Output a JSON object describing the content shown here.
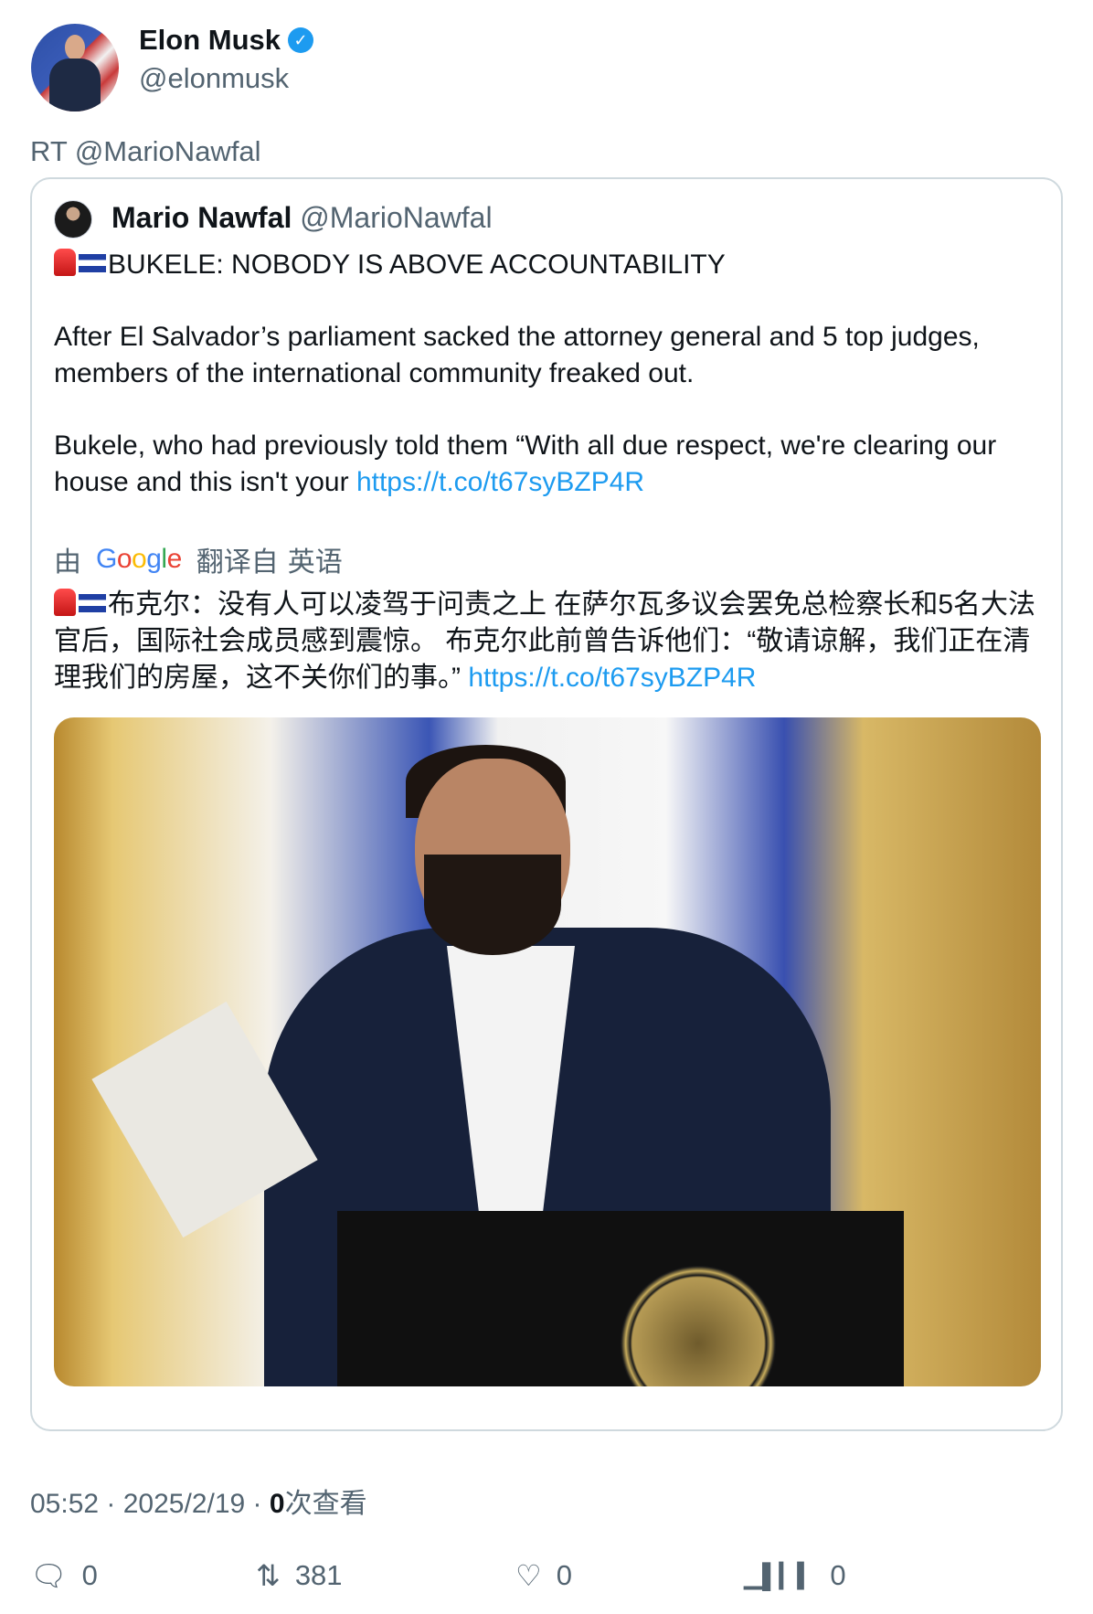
{
  "author": {
    "name": "Elon Musk",
    "handle": "@elonmusk",
    "verified": true
  },
  "retweet_label": "RT @MarioNawfal",
  "quoted": {
    "name": "Mario Nawfal",
    "handle": "@MarioNawfal",
    "headline": "BUKELE: NOBODY IS ABOVE ACCOUNTABILITY",
    "paragraph1": "After El Salvador’s parliament sacked the attorney general and 5 top judges, members of the international community freaked out.",
    "paragraph2": "Bukele, who had previously told them “With all due respect, we're clearing our house and this isn't your ",
    "link": "https://t.co/t67syBZP4R",
    "translation": {
      "by": "由",
      "provider": "Google",
      "from": "翻译自",
      "language": "英语",
      "text": "布克尔：没有人可以凌驾于问责之上 在萨尔瓦多议会罢免总检察长和5名大法官后，国际社会成员感到震惊。 布克尔此前曾告诉他们：“敬请谅解，我们正在清理我们的房屋，这不关你们的事。” ",
      "link": "https://t.co/t67syBZP4R"
    }
  },
  "meta": {
    "time": "05:52",
    "date": "2025/2/19",
    "views_count": "0",
    "views_label": "次查看",
    "separator": " · "
  },
  "actions": [
    {
      "icon": "reply-icon",
      "count": "0"
    },
    {
      "icon": "retweet-icon",
      "count": "381"
    },
    {
      "icon": "like-icon",
      "count": "0"
    },
    {
      "icon": "views-icon",
      "count": "0"
    }
  ],
  "colors": {
    "link": "#1d9bf0",
    "secondary": "#536471",
    "border": "#cfd9de",
    "verified": "#1d9bf0"
  }
}
